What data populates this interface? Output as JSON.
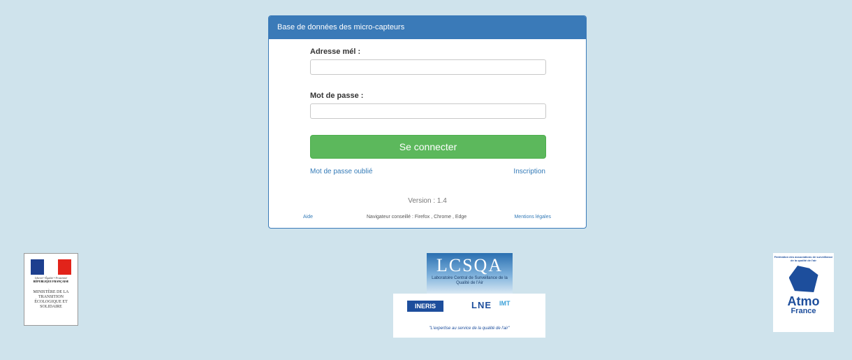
{
  "header": {
    "title": "Base de données des micro-capteurs"
  },
  "form": {
    "email_label": "Adresse mél :",
    "email_value": "",
    "password_label": "Mot de passe :",
    "password_value": "",
    "submit_label": "Se connecter",
    "forgot_link": "Mot de passe oublié",
    "signup_link": "Inscription"
  },
  "version": "Version : 1.4",
  "footer": {
    "help": "Aide",
    "browser_note": "Navigateur conseillé : Firefox , Chrome , Edge",
    "legal": "Mentions légales"
  },
  "logos": {
    "ministere_motto": "Liberté • Égalité • Fraternité",
    "ministere_republique": "RÉPUBLIQUE FRANÇAISE",
    "ministere_name": "MINISTÈRE DE LA TRANSITION ÉCOLOGIQUE ET SOLIDAIRE",
    "lcsqa_title": "LCSQA",
    "lcsqa_sub": "Laboratoire Central de Surveillance de la Qualité de l'Air",
    "ineris": "INERIS",
    "lne": "LNE",
    "imt": "IMT",
    "partners_tagline": "\"L'expertise au service de la qualité de l'air\"",
    "atmo_fed": "Fédération des associations de surveillance de la qualité de l'air",
    "atmo_name": "Atmo",
    "atmo_country": "France"
  },
  "colors": {
    "header": "#3a7ab8",
    "button": "#5cb85c",
    "background": "#cfe3ec",
    "link": "#337ab7"
  }
}
